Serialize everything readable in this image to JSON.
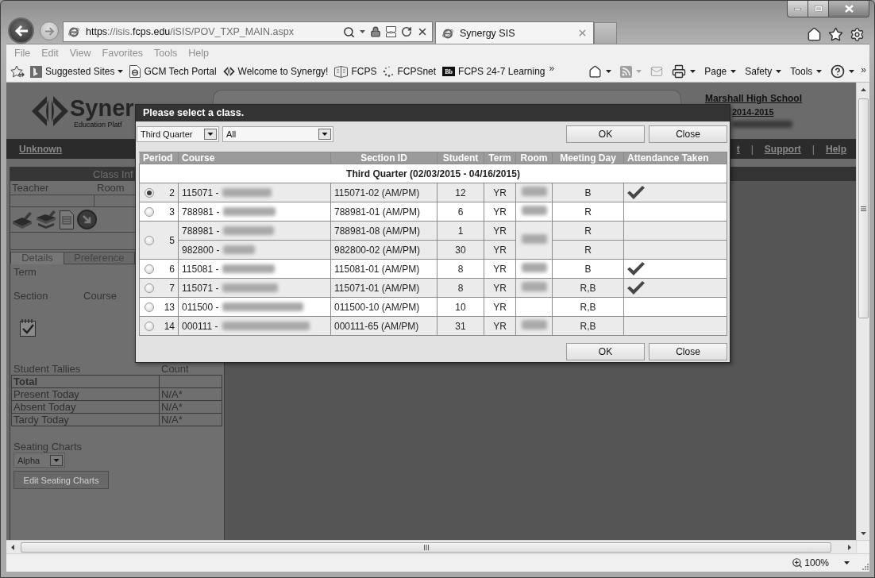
{
  "browser": {
    "url": "**https**://isis.**fcps.edu**/iSIS/POV_TXP_MAIN.aspx",
    "tabs": [
      {
        "title": "Synergy SIS",
        "selected": true
      }
    ],
    "menu": [
      "File",
      "Edit",
      "View",
      "Favorites",
      "Tools",
      "Help"
    ],
    "favorites": [
      {
        "label": "Suggested Sites",
        "dropdown": true
      },
      {
        "label": "GCM Tech Portal",
        "dropdown": false
      },
      {
        "label": "Welcome to Synergy!",
        "dropdown": false
      },
      {
        "label": "FCPS",
        "dropdown": false
      },
      {
        "label": "FCPSnet",
        "dropdown": false
      },
      {
        "label": "FCPS 24-7 Learning",
        "dropdown": false,
        "badge": "Bb"
      }
    ],
    "favorites_overflow": "»",
    "commands": [
      {
        "kind": "icon",
        "dropdown": true,
        "disabled": false
      },
      {
        "kind": "icon",
        "dropdown": true,
        "disabled": true
      },
      {
        "kind": "icon",
        "dropdown": false,
        "disabled": true
      },
      {
        "kind": "icon",
        "dropdown": true,
        "disabled": false
      },
      {
        "kind": "text",
        "label": "Page",
        "dropdown": true,
        "disabled": false
      },
      {
        "kind": "text",
        "label": "Safety",
        "dropdown": true,
        "disabled": false
      },
      {
        "kind": "text",
        "label": "Tools",
        "dropdown": true,
        "disabled": false
      },
      {
        "kind": "icon",
        "dropdown": true,
        "disabled": false
      }
    ],
    "commands_overflow": "»",
    "zoom": "100%"
  },
  "page": {
    "logo": {
      "name": "Syner",
      "tagline": "Education Platf"
    },
    "school": {
      "name": "Marshall High School",
      "year": "2014-2015"
    },
    "nav": {
      "user": "Unknown",
      "items": [
        {
          "kind": "link",
          "label": "t"
        },
        {
          "kind": "separator",
          "label": "|"
        },
        {
          "kind": "link",
          "label": "Support"
        },
        {
          "kind": "separator",
          "label": "|"
        },
        {
          "kind": "link",
          "label": "Help"
        }
      ]
    },
    "class_info": {
      "title": "Class Inf",
      "teacher_label": "Teacher",
      "room_label": "Room",
      "tabs": [
        {
          "label": "Details",
          "selected": true
        },
        {
          "label": "Preference",
          "selected": false
        }
      ],
      "term_label": "Term",
      "section_label": "Section",
      "course_label": "Course"
    },
    "tallies": {
      "title": "Student Tallies",
      "count_label": "Count",
      "rows": [
        {
          "kind": "total",
          "label": "Total"
        },
        {
          "kind": "item",
          "label": "Present Today",
          "value": "N/A*"
        },
        {
          "kind": "item",
          "label": "Absent Today",
          "value": "N/A*"
        },
        {
          "kind": "item",
          "label": "Tardy Today",
          "value": "N/A*"
        }
      ]
    },
    "seating": {
      "title": "Seating Charts",
      "chart": "Alpha",
      "edit_label": "Edit Seating Charts",
      "edit_disabled": true
    }
  },
  "dialog": {
    "title": "Please select a class.",
    "term": "Third Quarter",
    "filter": "All",
    "top_buttons": [
      "OK",
      "Close"
    ],
    "bottom_buttons": [
      "OK",
      "Close"
    ],
    "columns": [
      "Period",
      "Course",
      "Section ID",
      "Student",
      "Term",
      "Room",
      "Meeting Day",
      "Attendance Taken"
    ],
    "group": "Third Quarter (02/03/2015 - 04/16/2015)",
    "rows": [
      {
        "period": "2",
        "selected": true,
        "room_blurred": true,
        "sections": [
          {
            "course": "115071 -",
            "section_id": "115071-02 (AM/PM)",
            "students": "12",
            "term": "YR",
            "meeting_day": "B",
            "attendance_taken": true
          }
        ]
      },
      {
        "period": "3",
        "selected": false,
        "room_blurred": true,
        "sections": [
          {
            "course": "788981 -",
            "section_id": "788981-01 (AM/PM)",
            "students": "6",
            "term": "YR",
            "meeting_day": "R",
            "attendance_taken": false
          }
        ]
      },
      {
        "period": "5",
        "selected": false,
        "room_blurred": true,
        "sections": [
          {
            "course": "788981 -",
            "section_id": "788981-08 (AM/PM)",
            "students": "1",
            "term": "YR",
            "meeting_day": "R",
            "attendance_taken": false
          },
          {
            "course": "982800 -",
            "section_id": "982800-02 (AM/PM)",
            "students": "30",
            "term": "YR",
            "meeting_day": "R",
            "attendance_taken": false
          }
        ]
      },
      {
        "period": "6",
        "selected": false,
        "room_blurred": true,
        "sections": [
          {
            "course": "115081 -",
            "section_id": "115081-01 (AM/PM)",
            "students": "8",
            "term": "YR",
            "meeting_day": "B",
            "attendance_taken": true
          }
        ]
      },
      {
        "period": "7",
        "selected": false,
        "room_blurred": true,
        "sections": [
          {
            "course": "115071 -",
            "section_id": "115071-01 (AM/PM)",
            "students": "8",
            "term": "YR",
            "meeting_day": "R,B",
            "attendance_taken": true
          }
        ]
      },
      {
        "period": "13",
        "selected": false,
        "room_blurred": false,
        "sections": [
          {
            "course": "011500 -",
            "section_id": "011500-10 (AM/PM)",
            "students": "10",
            "term": "YR",
            "meeting_day": "R,B",
            "attendance_taken": false
          }
        ]
      },
      {
        "period": "14",
        "selected": false,
        "room_blurred": true,
        "sections": [
          {
            "course": "000111 -",
            "section_id": "000111-65 (AM/PM)",
            "students": "31",
            "term": "YR",
            "meeting_day": "R,B",
            "attendance_taken": false
          }
        ]
      }
    ]
  }
}
